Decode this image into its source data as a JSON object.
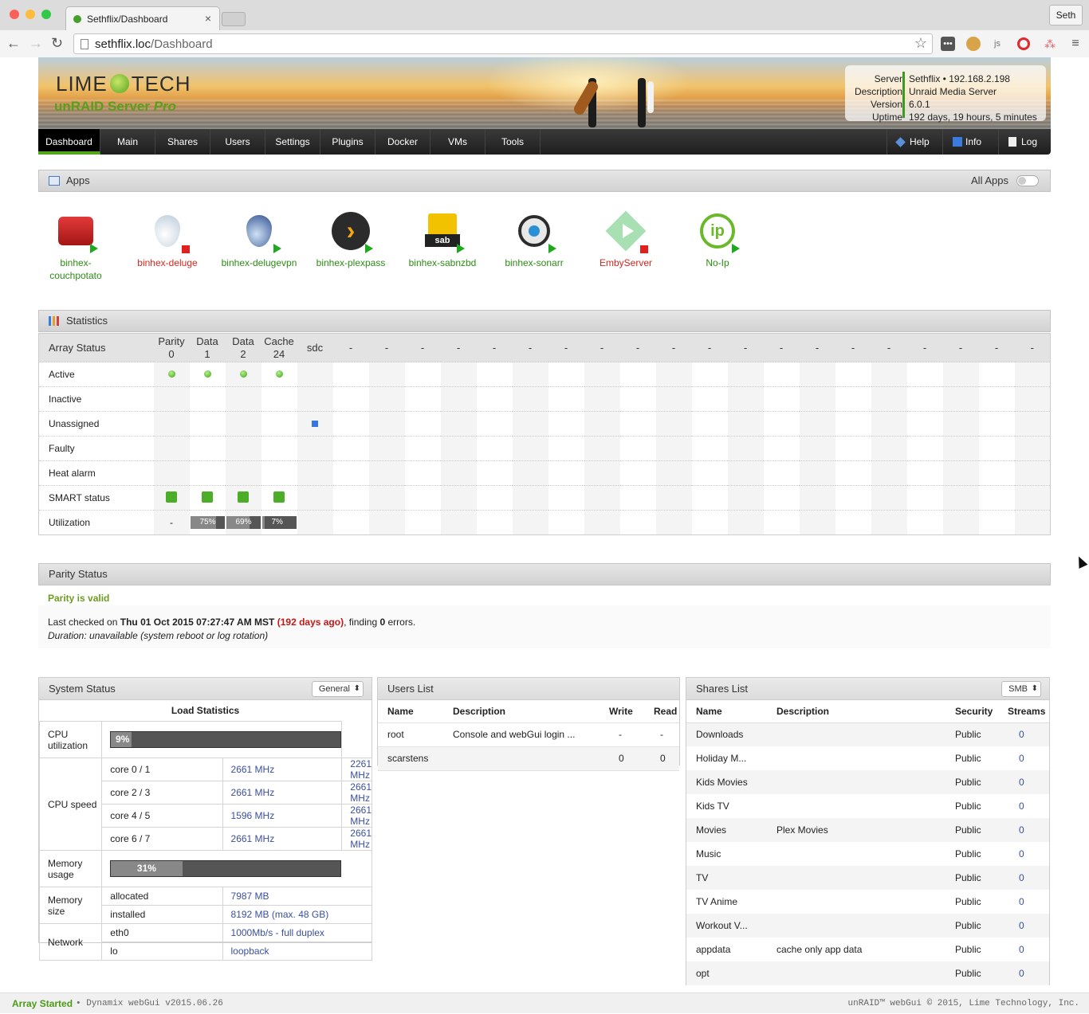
{
  "browser": {
    "tab_title": "Sethflix/Dashboard",
    "tab_close": "×",
    "url_host": "sethflix.loc",
    "url_path": "/Dashboard",
    "user_label": "Seth",
    "ext_js": "js"
  },
  "header": {
    "logo_text_left": "LIME",
    "logo_text_right": "TECH",
    "product": "unRAID Server",
    "edition": "Pro",
    "server_label": "Server",
    "server_value": "Sethflix • 192.168.2.198",
    "description_label": "Description",
    "description_value": "Unraid Media Server",
    "version_label": "Version",
    "version_value": "6.0.1",
    "uptime_label": "Uptime",
    "uptime_value": "192 days, 19 hours, 5 minutes"
  },
  "menu": {
    "items": [
      "Dashboard",
      "Main",
      "Shares",
      "Users",
      "Settings",
      "Plugins",
      "Docker",
      "VMs",
      "Tools"
    ],
    "active": "Dashboard",
    "help": "Help",
    "info": "Info",
    "log": "Log"
  },
  "apps": {
    "title": "Apps",
    "all_apps_label": "All Apps",
    "items": [
      {
        "name": "binhex-\ncouchpotato",
        "line1": "binhex-",
        "line2": "couchpotato",
        "status": "started",
        "icon": "couchpotato-icon"
      },
      {
        "name": "binhex-deluge",
        "line1": "binhex-deluge",
        "line2": "",
        "status": "stopped",
        "icon": "deluge-icon"
      },
      {
        "name": "binhex-delugevpn",
        "line1": "binhex-delugevpn",
        "line2": "",
        "status": "started",
        "icon": "delugevpn-icon"
      },
      {
        "name": "binhex-plexpass",
        "line1": "binhex-plexpass",
        "line2": "",
        "status": "started",
        "icon": "plex-icon"
      },
      {
        "name": "binhex-sabnzbd",
        "line1": "binhex-sabnzbd",
        "line2": "",
        "status": "started",
        "icon": "sabnzbd-icon"
      },
      {
        "name": "binhex-sonarr",
        "line1": "binhex-sonarr",
        "line2": "",
        "status": "started",
        "icon": "sonarr-icon"
      },
      {
        "name": "EmbyServer",
        "line1": "EmbyServer",
        "line2": "",
        "status": "stopped",
        "icon": "emby-icon"
      },
      {
        "name": "No-Ip",
        "line1": "No-Ip",
        "line2": "",
        "status": "started",
        "icon": "noip-icon"
      }
    ]
  },
  "statistics": {
    "title": "Statistics",
    "header_label": "Array Status",
    "disks": [
      {
        "l1": "Parity",
        "l2": "0"
      },
      {
        "l1": "Data",
        "l2": "1"
      },
      {
        "l1": "Data",
        "l2": "2"
      },
      {
        "l1": "Cache",
        "l2": "24"
      },
      {
        "l1": "sdc",
        "l2": ""
      }
    ],
    "empty_col": "-",
    "empty_count": 20,
    "rows": [
      "Active",
      "Inactive",
      "Unassigned",
      "Faulty",
      "Heat alarm",
      "SMART status",
      "Utilization"
    ],
    "utilization": [
      "-",
      "75%",
      "69%",
      "7%"
    ],
    "utilization_values": [
      null,
      75,
      69,
      7
    ]
  },
  "parity": {
    "title": "Parity Status",
    "status": "Parity is valid",
    "last_checked_prefix": "Last checked on",
    "last_checked_date": "Thu 01 Oct 2015 07:27:47 AM MST",
    "days_ago": "(192 days ago)",
    "finding": ", finding",
    "errors_count": "0",
    "errors_suffix": "errors.",
    "duration": "Duration: unavailable (system reboot or log rotation)"
  },
  "system_status": {
    "title": "System Status",
    "selector": "General",
    "load_title": "Load Statistics",
    "cpu_util_label": "CPU utilization",
    "cpu_util": "9%",
    "cpu_util_value": 9,
    "cpu_speed_label": "CPU speed",
    "cores": [
      {
        "core": "core 0 / 1",
        "a": "2661 MHz",
        "b": "2261 MHz"
      },
      {
        "core": "core 2 / 3",
        "a": "2661 MHz",
        "b": "2661 MHz"
      },
      {
        "core": "core 4 / 5",
        "a": "1596 MHz",
        "b": "2661 MHz"
      },
      {
        "core": "core 6 / 7",
        "a": "2661 MHz",
        "b": "2661 MHz"
      }
    ],
    "mem_usage_label": "Memory usage",
    "mem_usage": "31%",
    "mem_usage_value": 31,
    "mem_size_label": "Memory size",
    "allocated_label": "allocated",
    "allocated": "7987 MB",
    "installed_label": "installed",
    "installed": "8192 MB (max. 48 GB)",
    "network_label": "Network",
    "eth0_label": "eth0",
    "eth0": "1000Mb/s - full duplex",
    "lo_label": "lo",
    "lo": "loopback"
  },
  "users": {
    "title": "Users List",
    "headers": [
      "Name",
      "Description",
      "Write",
      "Read"
    ],
    "rows": [
      {
        "name": "root",
        "desc": "Console and webGui login ...",
        "write": "-",
        "read": "-"
      },
      {
        "name": "scarstens",
        "desc": "",
        "write": "0",
        "read": "0"
      }
    ]
  },
  "shares": {
    "title": "Shares List",
    "selector": "SMB",
    "headers": [
      "Name",
      "Description",
      "Security",
      "Streams"
    ],
    "rows": [
      {
        "name": "Downloads",
        "desc": "",
        "sec": "Public",
        "streams": "0"
      },
      {
        "name": "Holiday M...",
        "desc": "",
        "sec": "Public",
        "streams": "0"
      },
      {
        "name": "Kids Movies",
        "desc": "",
        "sec": "Public",
        "streams": "0"
      },
      {
        "name": "Kids TV",
        "desc": "",
        "sec": "Public",
        "streams": "0"
      },
      {
        "name": "Movies",
        "desc": "Plex Movies",
        "sec": "Public",
        "streams": "0"
      },
      {
        "name": "Music",
        "desc": "",
        "sec": "Public",
        "streams": "0"
      },
      {
        "name": "TV",
        "desc": "",
        "sec": "Public",
        "streams": "0"
      },
      {
        "name": "TV Anime",
        "desc": "",
        "sec": "Public",
        "streams": "0"
      },
      {
        "name": "Workout V...",
        "desc": "",
        "sec": "Public",
        "streams": "0"
      },
      {
        "name": "appdata",
        "desc": "cache only app data",
        "sec": "Public",
        "streams": "0"
      },
      {
        "name": "opt",
        "desc": "",
        "sec": "Public",
        "streams": "0"
      }
    ]
  },
  "footer": {
    "array_status": "Array Started",
    "version": "• Dynamix webGui v2015.06.26",
    "copyright": "unRAID™ webGui © 2015, Lime Technology, Inc."
  },
  "colors": {
    "accent": "#53a618",
    "started": "#2d8c17",
    "stopped": "#d9261c",
    "link": "#3a4fa0"
  }
}
